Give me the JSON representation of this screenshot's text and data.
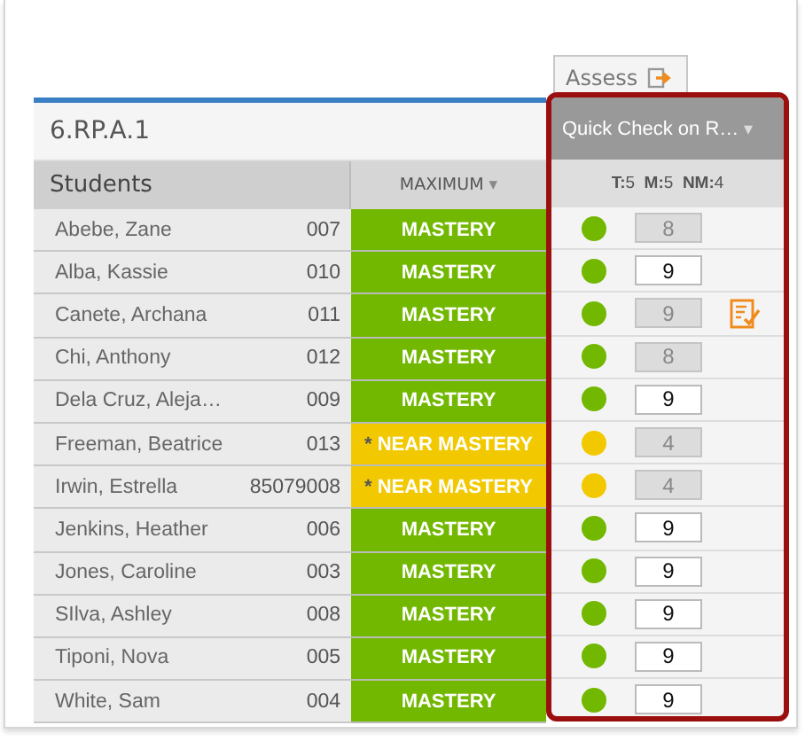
{
  "assess_button": {
    "label": "Assess"
  },
  "standard": {
    "title": "6.RP.A.1"
  },
  "assessment": {
    "title": "Quick Check on R…",
    "caret": "▾",
    "summary": [
      {
        "label": "T:",
        "value": "5"
      },
      {
        "label": "M:",
        "value": "5"
      },
      {
        "label": "NM:",
        "value": "4"
      }
    ]
  },
  "columns": {
    "students": "Students",
    "maximum": "MAXIMUM",
    "maximum_caret": "▾"
  },
  "rows": [
    {
      "name": "Abebe, Zane",
      "id": "007",
      "kind": "mastery",
      "label": "MASTERY",
      "color": "#72b800",
      "score": "8",
      "editable": false,
      "note": false
    },
    {
      "name": "Alba, Kassie",
      "id": "010",
      "kind": "mastery",
      "label": "MASTERY",
      "color": "#72b800",
      "score": "9",
      "editable": true,
      "note": false
    },
    {
      "name": "Canete, Archana",
      "id": "011",
      "kind": "mastery",
      "label": "MASTERY",
      "color": "#72b800",
      "score": "9",
      "editable": false,
      "note": true
    },
    {
      "name": "Chi, Anthony",
      "id": "012",
      "kind": "mastery",
      "label": "MASTERY",
      "color": "#72b800",
      "score": "8",
      "editable": false,
      "note": false
    },
    {
      "name": "Dela Cruz, Aleja…",
      "id": "009",
      "kind": "mastery",
      "label": "MASTERY",
      "color": "#72b800",
      "score": "9",
      "editable": true,
      "note": false
    },
    {
      "name": "Freeman, Beatrice",
      "id": "013",
      "kind": "near",
      "marker": "*",
      "label": "NEAR MASTERY",
      "color": "#f2c900",
      "score": "4",
      "editable": false,
      "note": false
    },
    {
      "name": "Irwin, Estrella",
      "id": "85079008",
      "kind": "near",
      "marker": "*",
      "label": "NEAR MASTERY",
      "color": "#f2c900",
      "score": "4",
      "editable": false,
      "note": false
    },
    {
      "name": "Jenkins, Heather",
      "id": "006",
      "kind": "mastery",
      "label": "MASTERY",
      "color": "#72b800",
      "score": "9",
      "editable": true,
      "note": false
    },
    {
      "name": "Jones, Caroline",
      "id": "003",
      "kind": "mastery",
      "label": "MASTERY",
      "color": "#72b800",
      "score": "9",
      "editable": true,
      "note": false
    },
    {
      "name": "SIlva, Ashley",
      "id": "008",
      "kind": "mastery",
      "label": "MASTERY",
      "color": "#72b800",
      "score": "9",
      "editable": true,
      "note": false
    },
    {
      "name": "Tiponi, Nova",
      "id": "005",
      "kind": "mastery",
      "label": "MASTERY",
      "color": "#72b800",
      "score": "9",
      "editable": true,
      "note": false
    },
    {
      "name": "White, Sam",
      "id": "004",
      "kind": "mastery",
      "label": "MASTERY",
      "color": "#72b800",
      "score": "9",
      "editable": true,
      "note": false
    }
  ]
}
